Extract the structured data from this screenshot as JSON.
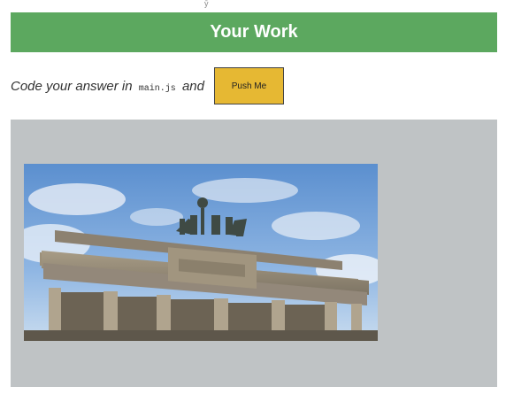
{
  "stray_mark": "ȳ",
  "header": {
    "title": "Your Work",
    "background": "#5ca85f"
  },
  "instructions": {
    "prefix": "Code your answer in",
    "code": "main.js",
    "suffix": "and"
  },
  "push_button": {
    "label": "Push Me",
    "background": "#e6b833"
  },
  "work_area": {
    "background": "#bfc3c5",
    "image_subject": "brandenburg-gate"
  }
}
